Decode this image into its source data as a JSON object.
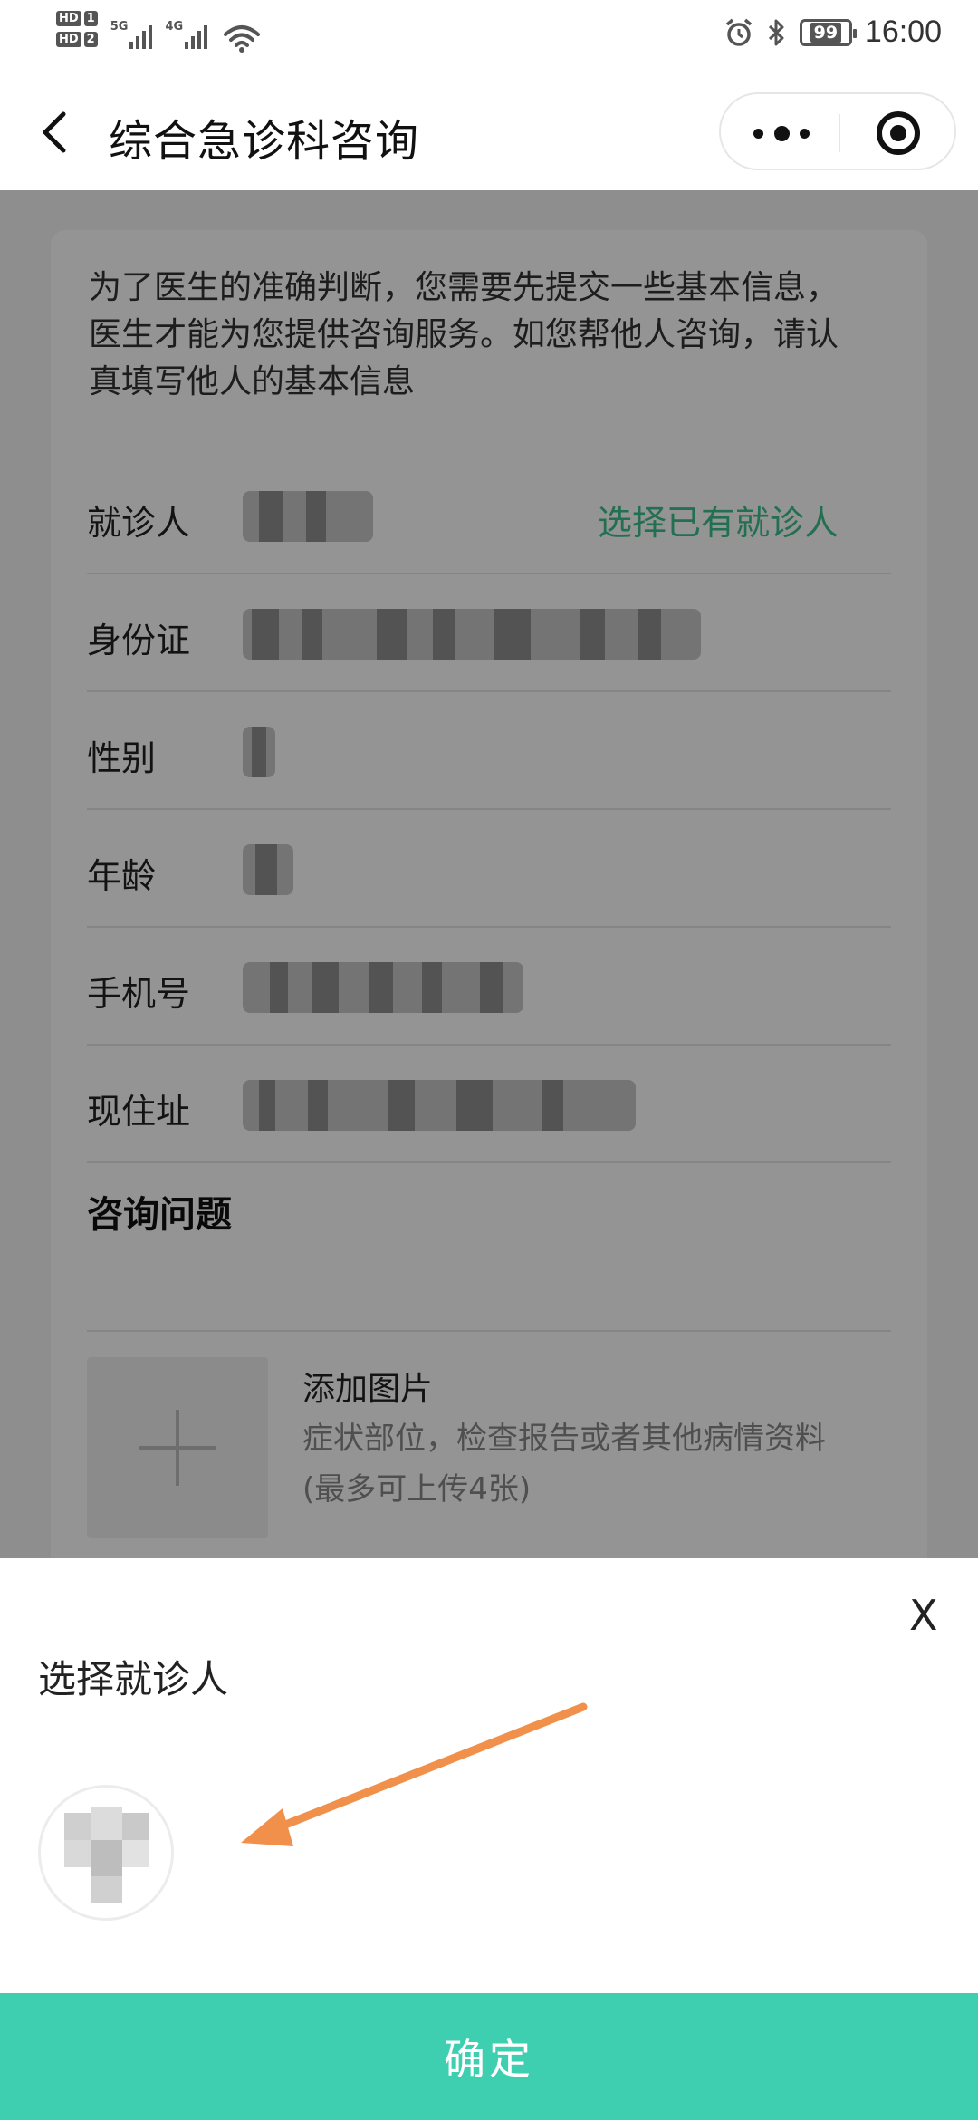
{
  "status_bar": {
    "sim1": "HD",
    "sim1_num": "1",
    "sim2": "HD",
    "sim2_num": "2",
    "net1": "5G",
    "net2": "4G",
    "battery": "99",
    "time": "16:00"
  },
  "nav": {
    "title": "综合急诊科咨询",
    "icons": [
      "back-chevron-icon",
      "more-dots-icon",
      "target-icon"
    ]
  },
  "form": {
    "intro": "为了医生的准确判断，您需要先提交一些基本信息，医生才能为您提供咨询服务。如您帮他人咨询，请认真填写他人的基本信息",
    "select_patient_link": "选择已有就诊人",
    "rows": [
      {
        "label": "就诊人"
      },
      {
        "label": "身份证"
      },
      {
        "label": "性别"
      },
      {
        "label": "年龄"
      },
      {
        "label": "手机号"
      },
      {
        "label": "现住址"
      }
    ],
    "question_title": "咨询问题",
    "upload_title": "添加图片",
    "upload_desc_1": "症状部位，检查报告或者其他病情资料",
    "upload_desc_2": "(最多可上传4张)"
  },
  "sheet": {
    "close_label": "X",
    "title": "选择就诊人",
    "confirm_label": "确定",
    "annotation_color": "#f0904a",
    "accent_color": "#3ecfb1",
    "link_color": "#3bbf8e"
  }
}
